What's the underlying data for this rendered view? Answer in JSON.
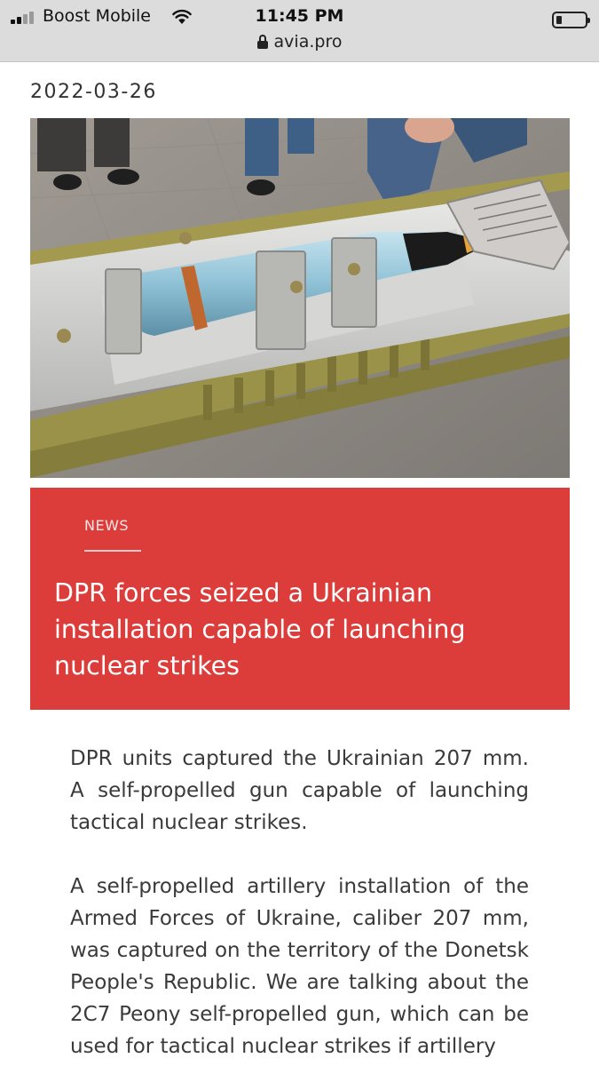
{
  "status_bar": {
    "carrier": "Boost Mobile",
    "time": "11:45 PM",
    "signal_icon": "signal-bars-icon",
    "wifi_icon": "wifi-icon",
    "battery_icon": "battery-icon",
    "battery_level": 0.15
  },
  "address_bar": {
    "url": "avia.pro",
    "lock_icon": "lock-icon"
  },
  "article": {
    "date": "2022-03-26",
    "image_alt": "photo-of-artillery-shell",
    "category": "NEWS",
    "title": "DPR forces seized a Ukrainian installation capable of launching nuclear strikes",
    "paragraphs": [
      "DPR units captured the Ukrainian 207 mm. A self-propelled gun capable of launching tactical nuclear strikes.",
      "A self-propelled artillery installation of the Armed Forces of Ukraine, caliber 207 mm, was captured on the territory of the Donetsk People's Republic. We are talking about the 2C7 Peony self-propelled gun, which can be used for tactical nuclear strikes if artillery"
    ]
  },
  "colors": {
    "card_background": "#dc3d3b",
    "status_bar_background": "#dcdcdc"
  }
}
